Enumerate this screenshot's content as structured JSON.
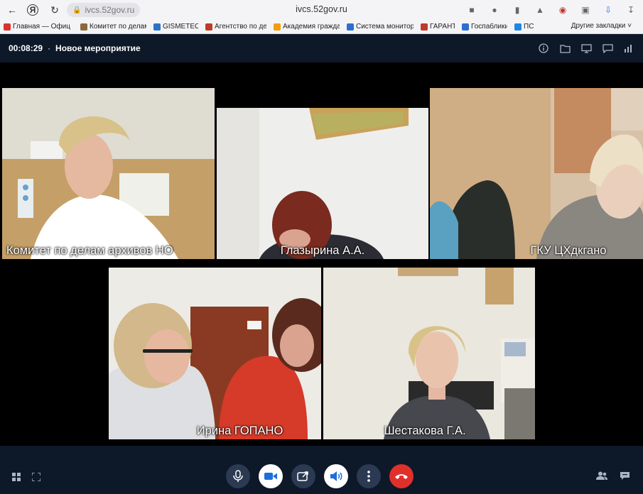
{
  "browser": {
    "url_pill": "ivcs.52gov.ru",
    "center_title": "ivcs.52gov.ru"
  },
  "bookmarks": {
    "items": [
      {
        "label": "Главная — Офиц",
        "color": "#d9342b"
      },
      {
        "label": "Комитет по делам",
        "color": "#8b6b3a"
      },
      {
        "label": "GISMETEO",
        "color": "#2a73c9"
      },
      {
        "label": "Агентство по дела",
        "color": "#c0392b"
      },
      {
        "label": "Академия гражда",
        "color": "#f39c12"
      },
      {
        "label": "Система монитор",
        "color": "#2c6fd1"
      },
      {
        "label": "ГАРАНТ",
        "color": "#c0392b"
      },
      {
        "label": "Госпаблики",
        "color": "#2c6fd1"
      },
      {
        "label": "ПС",
        "color": "#1e88e5"
      }
    ],
    "other": "Другие закладки"
  },
  "meeting": {
    "timer": "00:08:29",
    "separator": "·",
    "title": "Новое мероприятие"
  },
  "participants": [
    {
      "name": "Комитет по делам архивов НО"
    },
    {
      "name": "Глазырина А.А."
    },
    {
      "name": "ГКУ ЦХдкгано"
    },
    {
      "name": "Ирина ГОПАНО"
    },
    {
      "name": "Шестакова Г.А."
    }
  ],
  "colors": {
    "background": "#0d1829",
    "control_dark": "#2b3a52",
    "hangup": "#e0302b"
  }
}
